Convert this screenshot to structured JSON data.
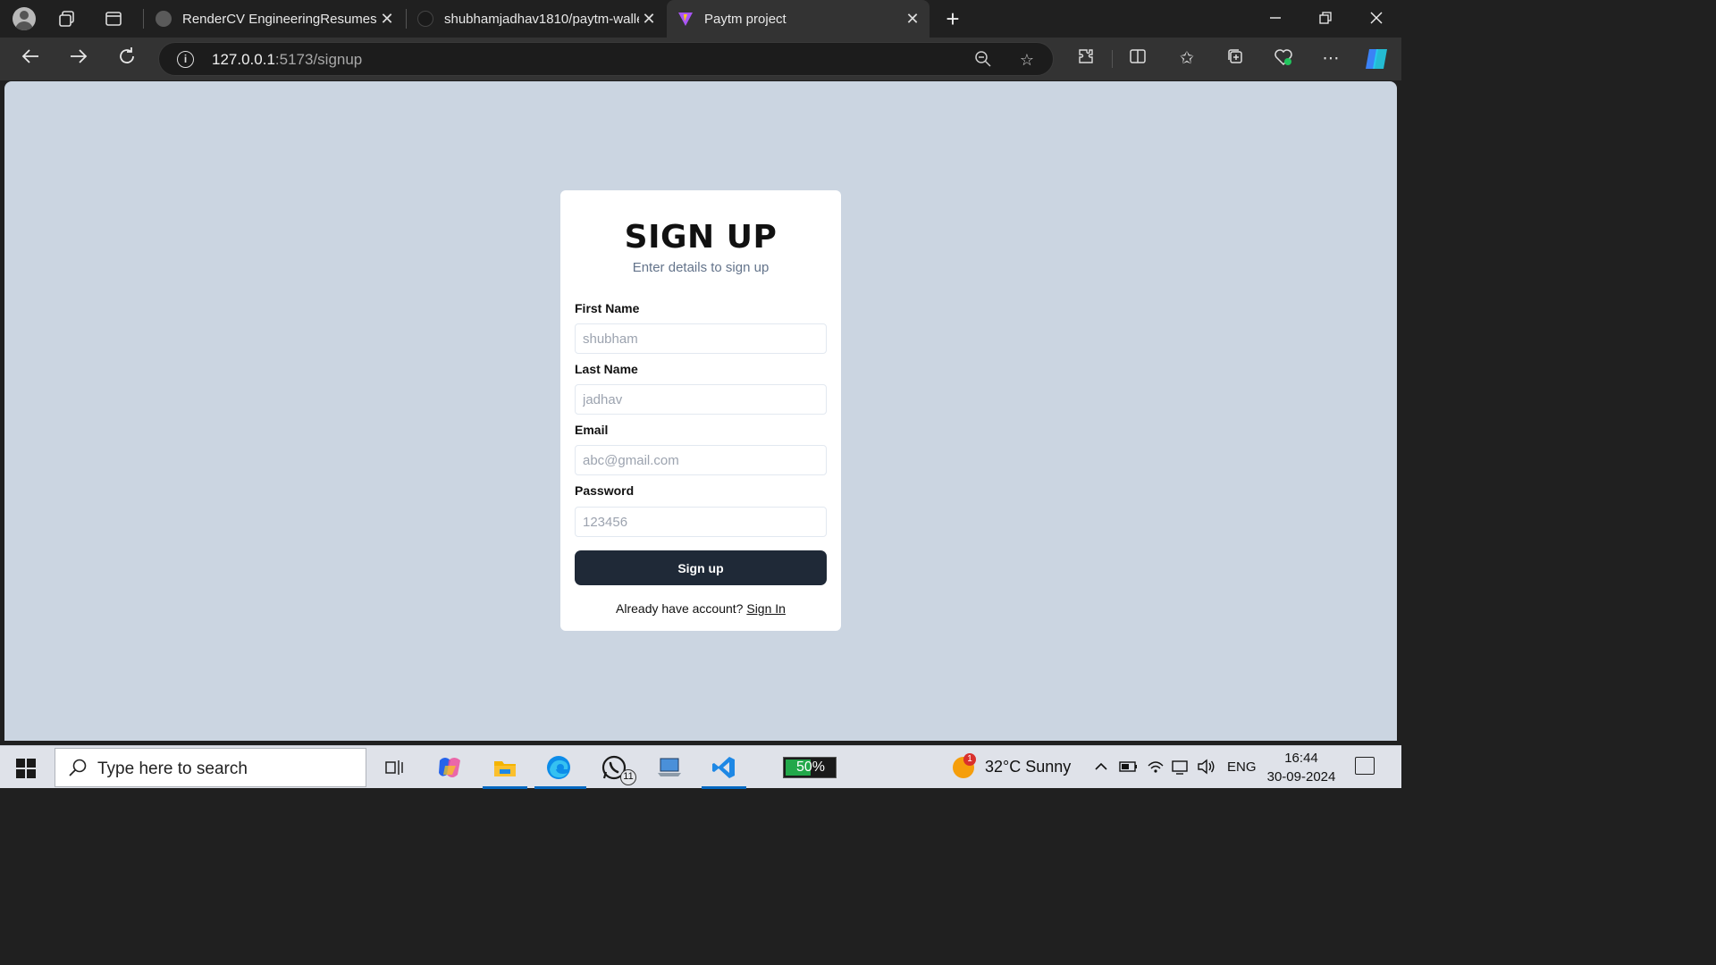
{
  "browser": {
    "tabs": [
      {
        "title": "RenderCV EngineeringResumes Th",
        "favicon_color": "#6b6b6b",
        "active": false
      },
      {
        "title": "shubhamjadhav1810/paytm-walle",
        "favicon_color": "#2b2b2b",
        "active": false
      },
      {
        "title": "Paytm project",
        "favicon_color": "#a855f7",
        "active": true
      }
    ],
    "tab_close": "✕",
    "new_tab": "+",
    "url_host": "127.0.0.1",
    "url_rest": ":5173/signup"
  },
  "signup": {
    "heading": "SIGN UP",
    "subheading": "Enter details to sign up",
    "first_name_label": "First Name",
    "first_name_placeholder": "shubham",
    "last_name_label": "Last Name",
    "last_name_placeholder": "jadhav",
    "email_label": "Email",
    "email_placeholder": "abc@gmail.com",
    "password_label": "Password",
    "password_placeholder": "123456",
    "button_label": "Sign up",
    "footer_text": "Already have account?",
    "footer_link": "Sign In"
  },
  "colors": {
    "page_bg": "#cbd5e1",
    "button_bg": "#1f2937",
    "subheading": "#64748b"
  },
  "taskbar": {
    "search_placeholder": "Type here to search",
    "battery_percent": "50%",
    "battery_level": 0.5,
    "weather_badge": "1",
    "weather": "32°C  Sunny",
    "language": "ENG",
    "time": "16:44",
    "date": "30-09-2024",
    "whatsapp_badge": "11"
  }
}
